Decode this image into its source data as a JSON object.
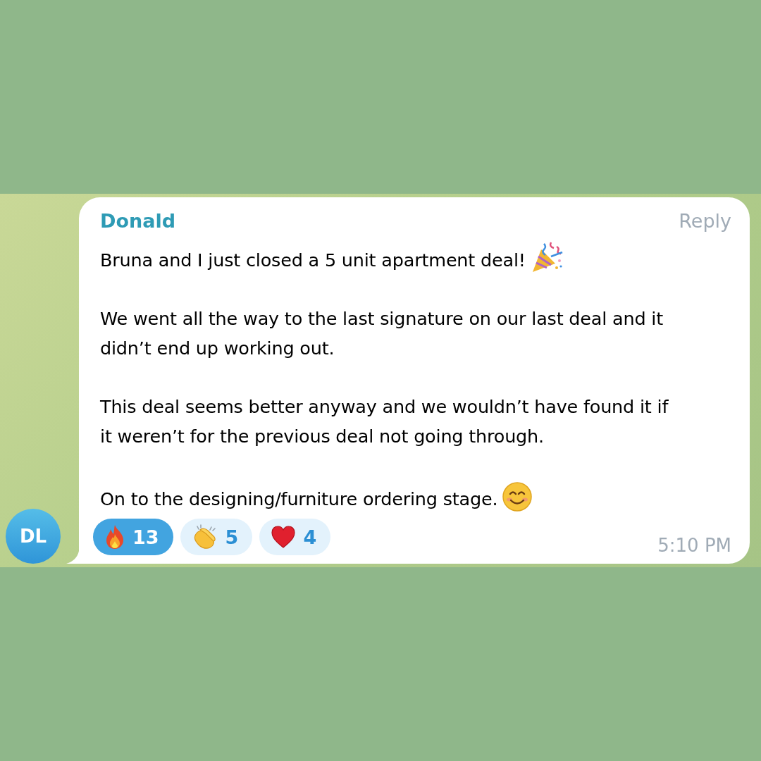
{
  "avatar": {
    "initials": "DL"
  },
  "message": {
    "sender": "Donald",
    "action": "Reply",
    "paragraphs": [
      {
        "text": "Bruna and I just closed a 5 unit apartment deal!",
        "kind": "party"
      },
      {
        "text": "We went all the way to the last signature on our last deal and it didn’t end up working out."
      },
      {
        "text": "This deal seems better anyway and we wouldn’t have found it if it weren’t for the previous deal not going through."
      },
      {
        "text": "On to the designing/furniture ordering stage.",
        "kind": "smile"
      }
    ],
    "reactions": [
      {
        "kind": "fire",
        "count": "13",
        "selected": true
      },
      {
        "kind": "clap",
        "count": "5",
        "selected": false
      },
      {
        "kind": "heart",
        "count": "4",
        "selected": false
      }
    ],
    "time": "5:10 PM"
  }
}
